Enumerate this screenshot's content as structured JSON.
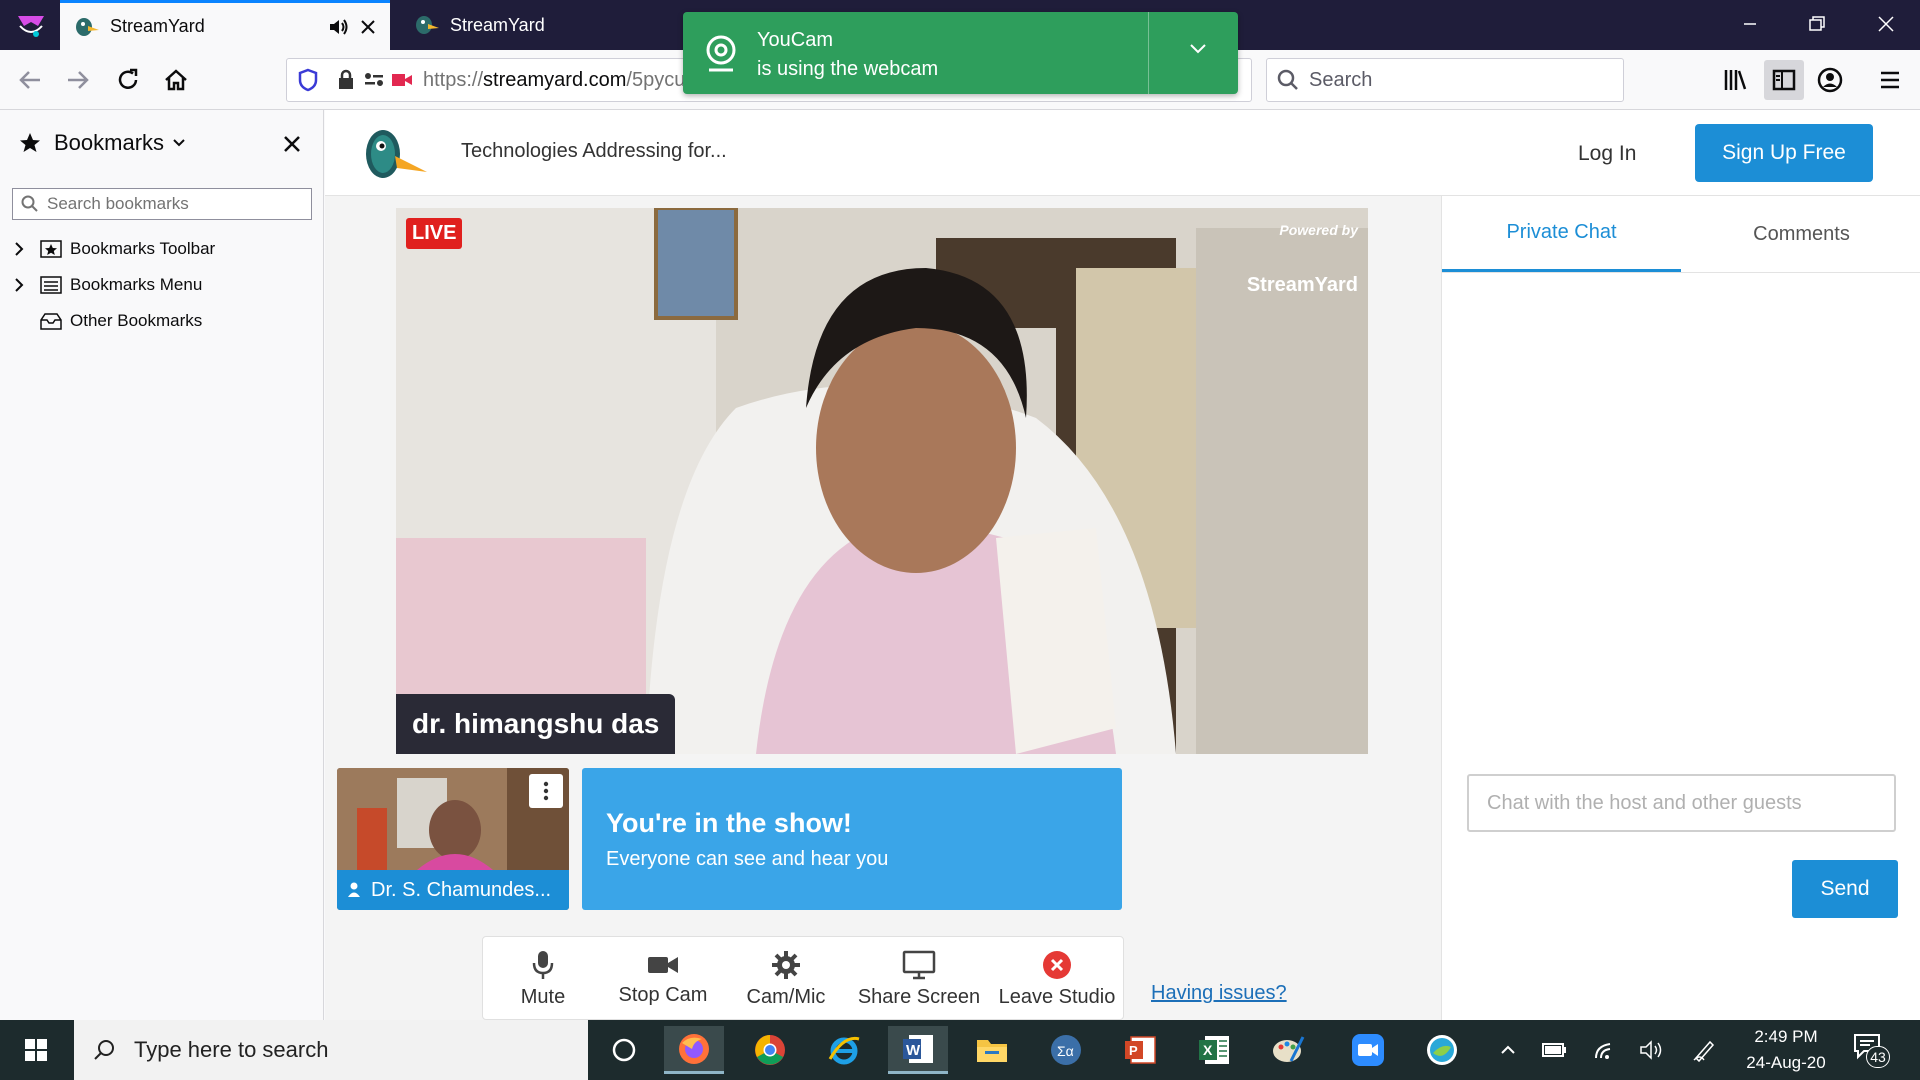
{
  "browser": {
    "tabs": [
      {
        "title": "StreamYard",
        "active": true
      },
      {
        "title": "StreamYard",
        "active": false
      }
    ],
    "url_prefix": "https://",
    "url_domain": "streamyard.com",
    "url_path": "/5pycuparvs",
    "search_placeholder": "Search"
  },
  "notification": {
    "app": "YouCam",
    "message": "is using the webcam",
    "color": "#2e9e5c"
  },
  "sidebar": {
    "title": "Bookmarks",
    "search_placeholder": "Search bookmarks",
    "items": [
      {
        "label": "Bookmarks Toolbar"
      },
      {
        "label": "Bookmarks Menu"
      },
      {
        "label": "Other Bookmarks"
      }
    ]
  },
  "streamyard": {
    "broadcast_title": "Technologies Addressing for...",
    "login": "Log In",
    "signup": "Sign Up Free",
    "live_label": "LIVE",
    "powered_by": "Powered by",
    "brand": "StreamYard",
    "speaker_name": "dr. himangshu das",
    "guest_name": "Dr. S. Chamundes...",
    "show_heading": "You're in the show!",
    "show_sub": "Everyone can see and hear you",
    "controls": {
      "mute": "Mute",
      "stop_cam": "Stop Cam",
      "cam_mic": "Cam/Mic",
      "share_screen": "Share Screen",
      "leave_studio": "Leave Studio"
    },
    "issues_link": "Having issues?",
    "chat": {
      "tab_private": "Private Chat",
      "tab_comments": "Comments",
      "input_placeholder": "Chat with the host and other guests",
      "send": "Send"
    },
    "accent_color": "#1c8ed6"
  },
  "taskbar": {
    "search_placeholder": "Type here to search",
    "time": "2:49 PM",
    "date": "24-Aug-20",
    "notification_count": "43"
  }
}
